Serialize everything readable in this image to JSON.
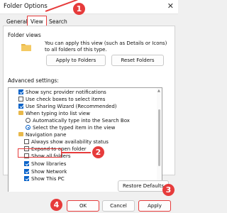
{
  "window": {
    "title": "Folder Options",
    "close_glyph": "✕"
  },
  "tabs": [
    {
      "label": "General"
    },
    {
      "label": "View"
    },
    {
      "label": "Search"
    }
  ],
  "folder_views": {
    "title": "Folder views",
    "description": "You can apply this view (such as Details or Icons) to all folders of this type.",
    "apply_button": "Apply to Folders",
    "reset_button": "Reset Folders"
  },
  "advanced": {
    "title": "Advanced settings:",
    "items": [
      {
        "type": "checkbox",
        "checked": true,
        "label": "Show sync provider notifications"
      },
      {
        "type": "checkbox",
        "checked": false,
        "label": "Use check boxes to select items"
      },
      {
        "type": "checkbox",
        "checked": true,
        "label": "Use Sharing Wizard (Recommended)"
      },
      {
        "type": "folder",
        "label": "When typing into list view"
      },
      {
        "type": "radio",
        "checked": false,
        "label": "Automatically type into the Search Box"
      },
      {
        "type": "radio",
        "checked": true,
        "label": "Select the typed item in the view"
      },
      {
        "type": "folder",
        "label": "Navigation pane"
      },
      {
        "type": "checkbox",
        "checked": false,
        "label": "Always show availability status"
      },
      {
        "type": "checkbox",
        "checked": false,
        "label": "Expand to open folder"
      },
      {
        "type": "checkbox",
        "checked": false,
        "label": "Show all folders"
      },
      {
        "type": "checkbox",
        "checked": true,
        "label": "Show libraries"
      },
      {
        "type": "checkbox",
        "checked": true,
        "label": "Show Network"
      },
      {
        "type": "checkbox",
        "checked": true,
        "label": "Show This PC"
      }
    ]
  },
  "restore_button": "Restore Defaults",
  "footer": {
    "ok": "OK",
    "cancel": "Cancel",
    "apply": "Apply"
  },
  "annotations": {
    "badge1": "1",
    "badge2": "2",
    "badge3": "3",
    "badge4": "4"
  },
  "colors": {
    "accent": "#0a63c9",
    "annotation": "#e63b3b"
  }
}
